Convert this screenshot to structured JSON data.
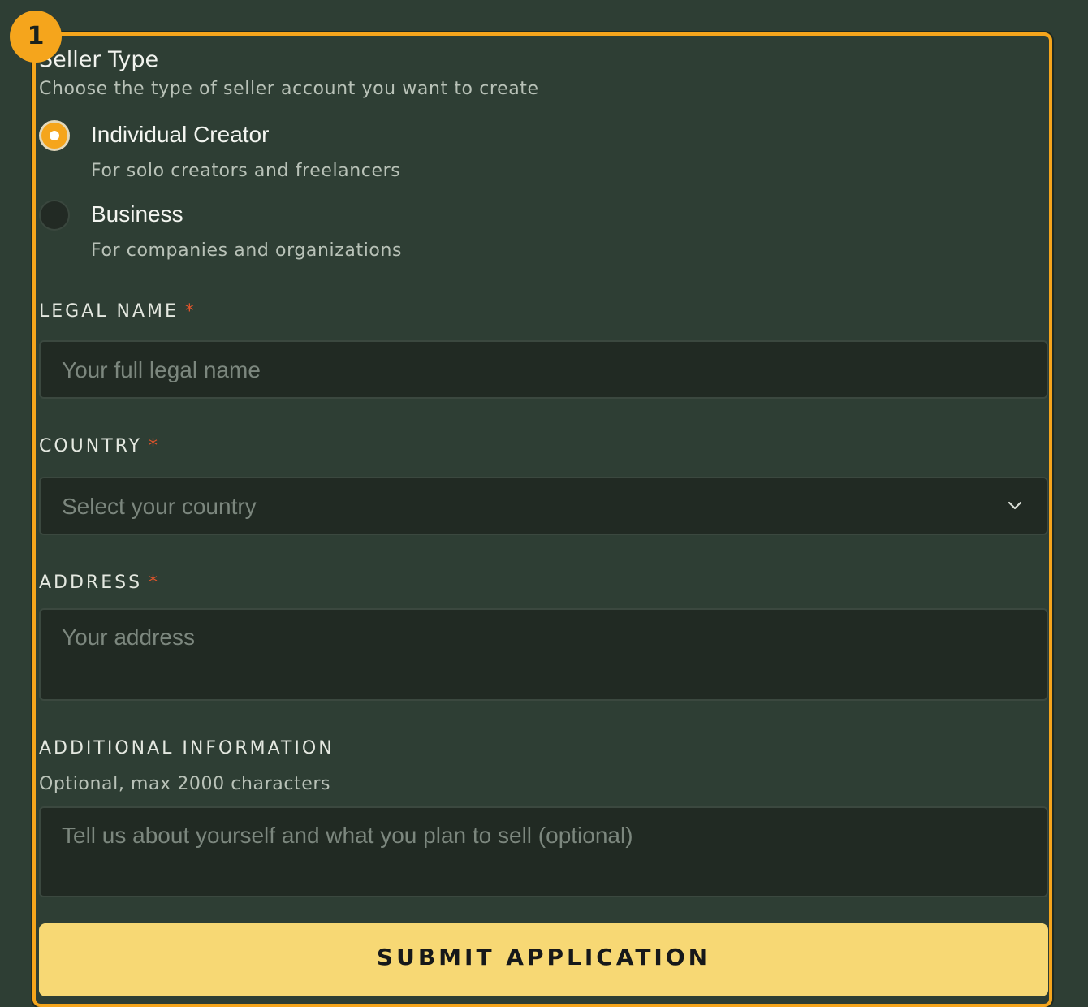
{
  "step_badge": "1",
  "seller_type": {
    "title": "Seller Type",
    "subtitle": "Choose the type of seller account you want to create",
    "options": [
      {
        "label": "Individual Creator",
        "description": "For solo creators and freelancers",
        "selected": true
      },
      {
        "label": "Business",
        "description": "For companies and organizations",
        "selected": false
      }
    ]
  },
  "legal_name": {
    "label": "LEGAL NAME",
    "required_marker": "*",
    "placeholder": "Your full legal name",
    "value": ""
  },
  "country": {
    "label": "COUNTRY",
    "required_marker": "*",
    "selected_text": "Select your country"
  },
  "address": {
    "label": "ADDRESS",
    "required_marker": "*",
    "placeholder": "Your address",
    "value": ""
  },
  "additional_info": {
    "label": "ADDITIONAL INFORMATION",
    "help": "Optional, max 2000 characters",
    "placeholder": "Tell us about yourself and what you plan to sell (optional)",
    "value": ""
  },
  "submit": {
    "label": "SUBMIT APPLICATION"
  },
  "colors": {
    "background": "#2e3e34",
    "accent": "#f5a51c",
    "submit_bg": "#f7d874",
    "required": "#e0552b",
    "input_bg": "#212a23"
  }
}
